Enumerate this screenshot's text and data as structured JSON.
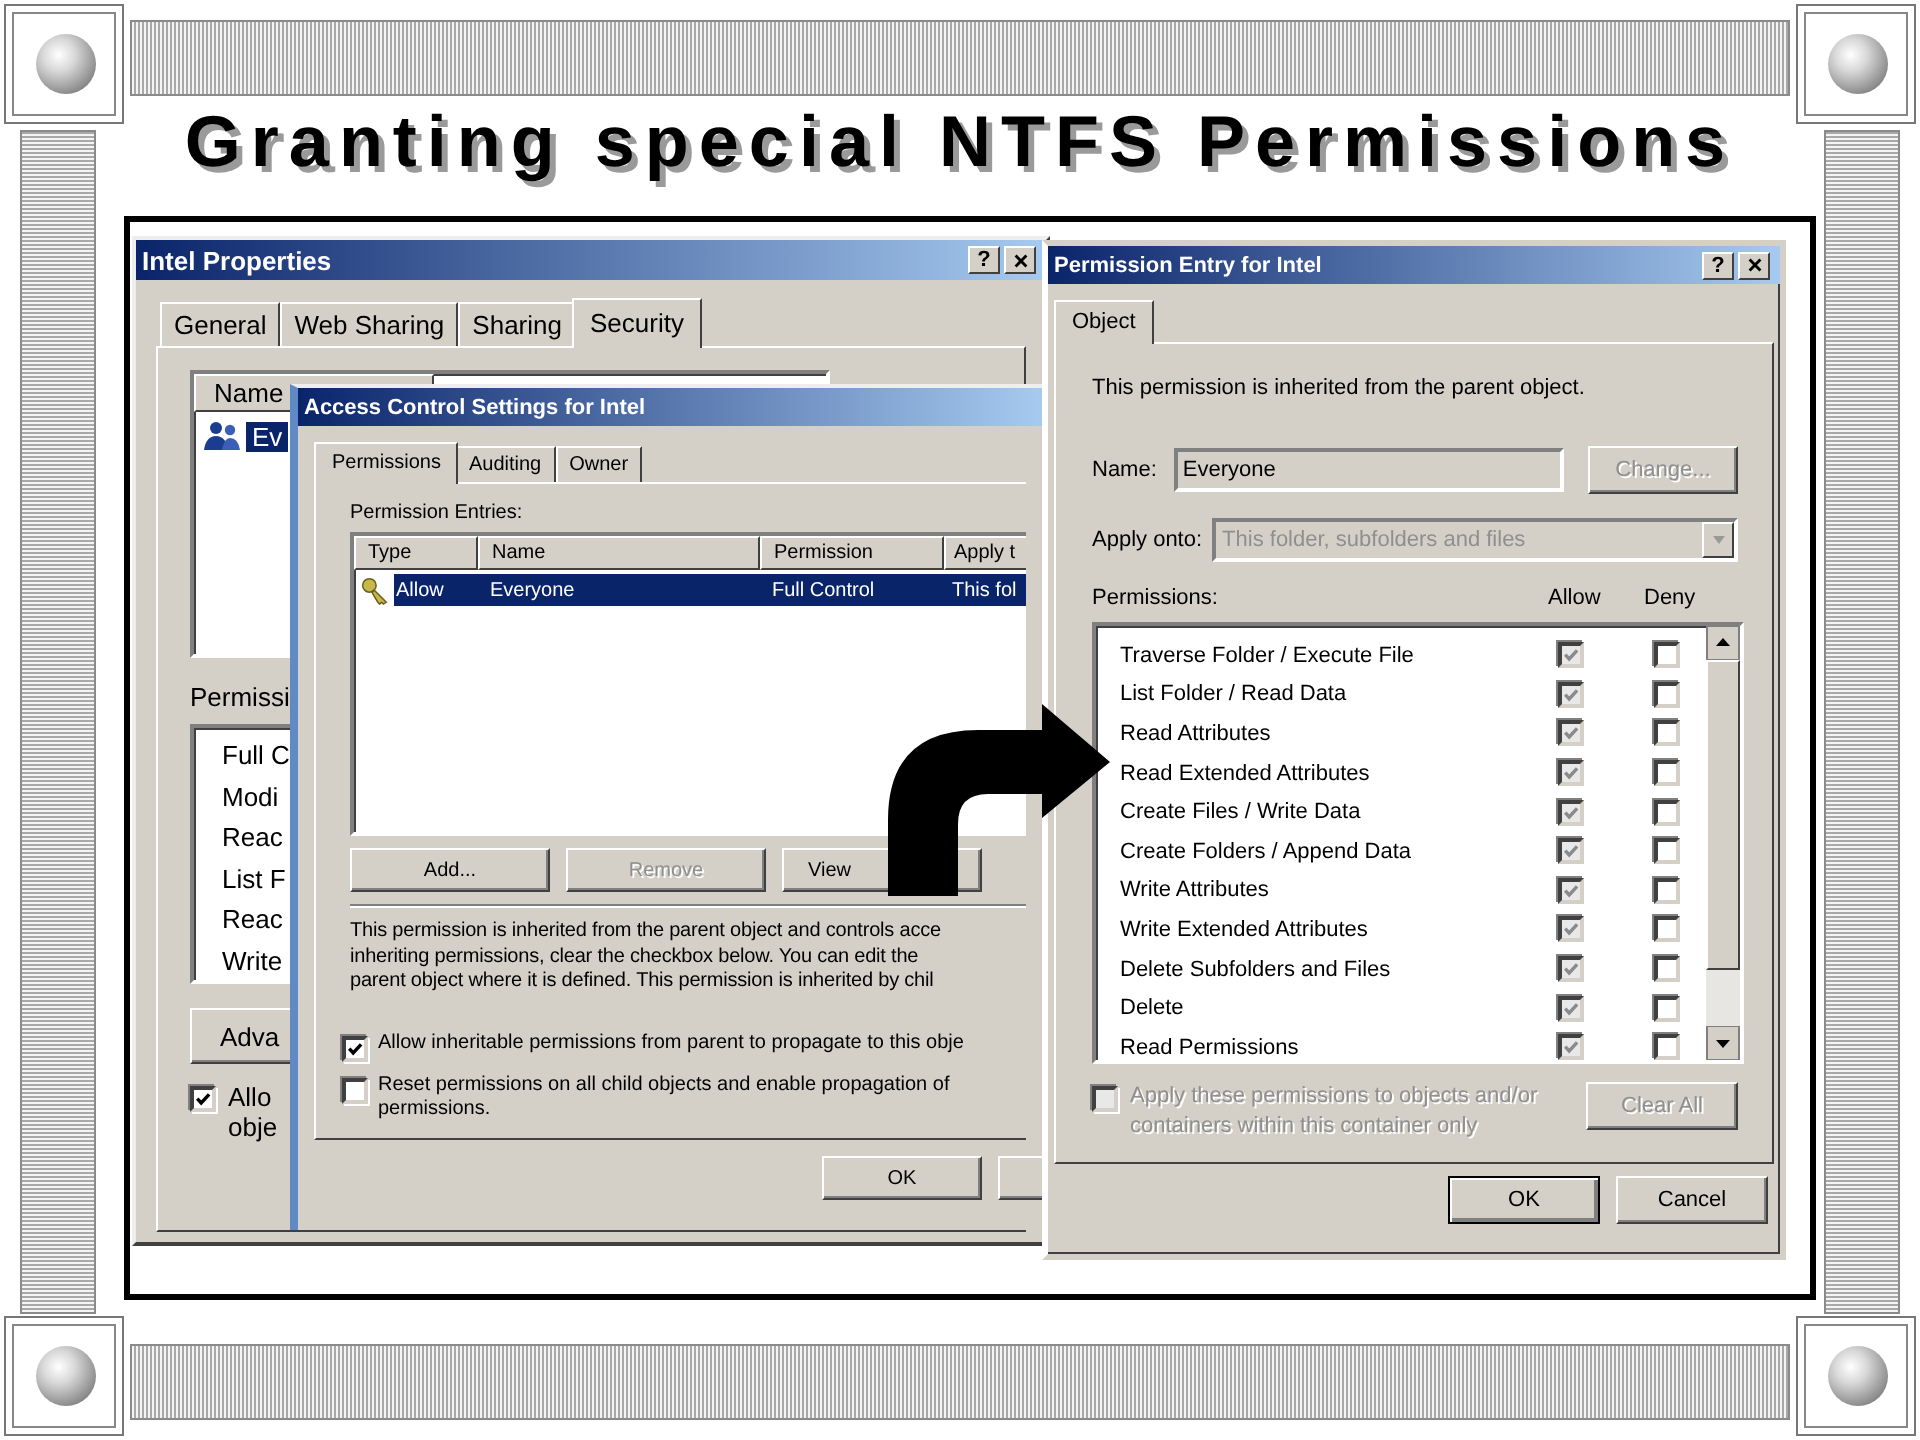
{
  "slide": {
    "title": "Granting special NTFS Permissions"
  },
  "properties_window": {
    "title": "Intel Properties",
    "help_button": "?",
    "tabs": [
      {
        "label": "General",
        "selected": false
      },
      {
        "label": "Web Sharing",
        "selected": false
      },
      {
        "label": "Sharing",
        "selected": false
      },
      {
        "label": "Security",
        "selected": true
      }
    ],
    "names_list": {
      "header": "Name",
      "items": [
        {
          "label": "Ev",
          "selected": true
        }
      ]
    },
    "permissions_label": "Permissi",
    "permissions_list": [
      "Full C",
      "Modi",
      "Reac",
      "List F",
      "Reac",
      "Write"
    ],
    "advanced_button": "Adva",
    "inherit_checkbox": {
      "lines": [
        "Allo",
        "obje"
      ],
      "checked": true
    }
  },
  "access_control_window": {
    "title": "Access Control Settings for Intel",
    "tabs": [
      {
        "label": "Permissions",
        "selected": true
      },
      {
        "label": "Auditing",
        "selected": false
      },
      {
        "label": "Owner",
        "selected": false
      }
    ],
    "entries_label": "Permission Entries:",
    "table": {
      "columns": [
        "Type",
        "Name",
        "Permission",
        "Apply t"
      ],
      "rows": [
        {
          "cells": [
            "Allow",
            "Everyone",
            "Full Control",
            "This fol"
          ],
          "selected": true
        }
      ]
    },
    "buttons": [
      {
        "label": "Add...",
        "disabled": false
      },
      {
        "label": "Remove",
        "disabled": true
      },
      {
        "label": "View",
        "disabled": false
      }
    ],
    "note_lines": [
      "This permission is inherited from the parent object and controls acce",
      "inheriting permissions, clear the checkbox below.  You can edit the",
      "parent object where it is defined. This permission is inherited by chil"
    ],
    "checkboxes": [
      {
        "lines": [
          "Allow inheritable permissions from parent to propagate to this obje"
        ],
        "checked": true
      },
      {
        "lines": [
          "Reset permissions on all child objects and enable propagation of",
          "permissions."
        ],
        "checked": false
      }
    ],
    "footer_buttons": [
      "OK"
    ]
  },
  "permission_entry_window": {
    "title": "Permission Entry for Intel",
    "help_button": "?",
    "tabs": [
      {
        "label": "Object",
        "selected": true
      }
    ],
    "inherited_note": "This permission is inherited from the parent object.",
    "name_label": "Name:",
    "name_value": "Everyone",
    "change_button": {
      "label": "Change...",
      "disabled": true
    },
    "apply_label": "Apply onto:",
    "apply_value": "This folder, subfolders and files",
    "apply_disabled": true,
    "permissions_label": "Permissions:",
    "allow_header": "Allow",
    "deny_header": "Deny",
    "permissions": [
      {
        "name": "Traverse Folder / Execute File",
        "allow": true,
        "deny": false,
        "inherited": true
      },
      {
        "name": "List Folder / Read Data",
        "allow": true,
        "deny": false,
        "inherited": true
      },
      {
        "name": "Read Attributes",
        "allow": true,
        "deny": false,
        "inherited": true
      },
      {
        "name": "Read Extended Attributes",
        "allow": true,
        "deny": false,
        "inherited": true
      },
      {
        "name": "Create Files / Write Data",
        "allow": true,
        "deny": false,
        "inherited": true
      },
      {
        "name": "Create Folders / Append Data",
        "allow": true,
        "deny": false,
        "inherited": true
      },
      {
        "name": "Write Attributes",
        "allow": true,
        "deny": false,
        "inherited": true
      },
      {
        "name": "Write Extended Attributes",
        "allow": true,
        "deny": false,
        "inherited": true
      },
      {
        "name": "Delete Subfolders and Files",
        "allow": true,
        "deny": false,
        "inherited": true
      },
      {
        "name": "Delete",
        "allow": true,
        "deny": false,
        "inherited": true
      },
      {
        "name": "Read Permissions",
        "allow": true,
        "deny": false,
        "inherited": true
      }
    ],
    "apply_checkbox": {
      "lines": [
        "Apply these permissions to objects and/or",
        "containers within this container only"
      ],
      "checked": false,
      "disabled": true
    },
    "clear_button": {
      "label": "Clear All",
      "disabled": true
    },
    "buttons": [
      {
        "label": "OK",
        "default": true
      },
      {
        "label": "Cancel",
        "default": false
      }
    ]
  }
}
